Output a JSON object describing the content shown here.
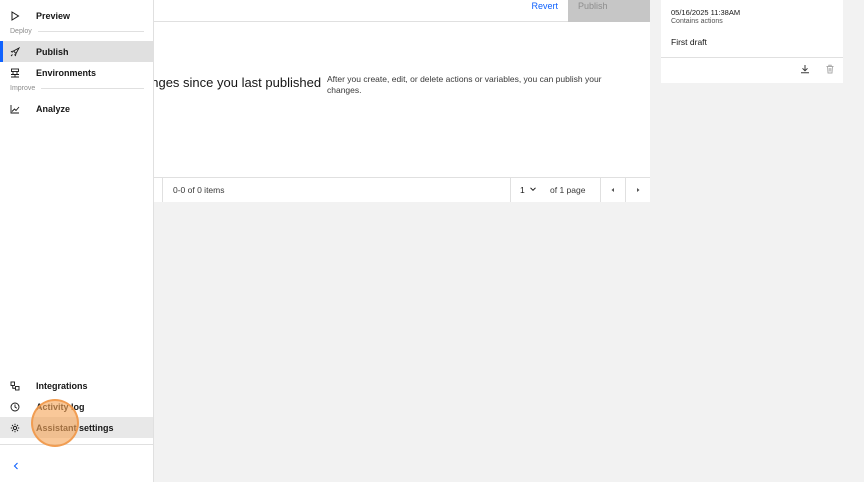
{
  "sidebar": {
    "items": [
      {
        "label": "Preview",
        "icon": "play-icon"
      },
      {
        "label": "Publish",
        "icon": "rocket-icon"
      },
      {
        "label": "Environments",
        "icon": "environments-icon"
      },
      {
        "label": "Analyze",
        "icon": "chart-line-icon"
      },
      {
        "label": "Integrations",
        "icon": "integrations-icon"
      },
      {
        "label": "Activity log",
        "icon": "clock-icon"
      },
      {
        "label": "Assistant settings",
        "icon": "gear-icon"
      }
    ],
    "sections": {
      "deploy": "Deploy",
      "improve": "Improve"
    },
    "collapse_icon": "chevron-left-icon"
  },
  "toolbar": {
    "revert_label": "Revert",
    "publish_label": "Publish"
  },
  "empty_state": {
    "title": "anges since you last published",
    "description": "After you create, edit, or delete actions or variables, you can publish your changes."
  },
  "pagination": {
    "items_text": "0-0 of 0 items",
    "page_value": "1",
    "of_pages_text": "of 1 page"
  },
  "version_card": {
    "date": "05/16/2025 11:38AM",
    "subtitle": "Contains actions",
    "note": "First draft"
  },
  "colors": {
    "accent": "#0f62fe",
    "active_bg": "#e0e0e0",
    "background": "#f2f2f2",
    "click_marker": "#f5a65a"
  }
}
